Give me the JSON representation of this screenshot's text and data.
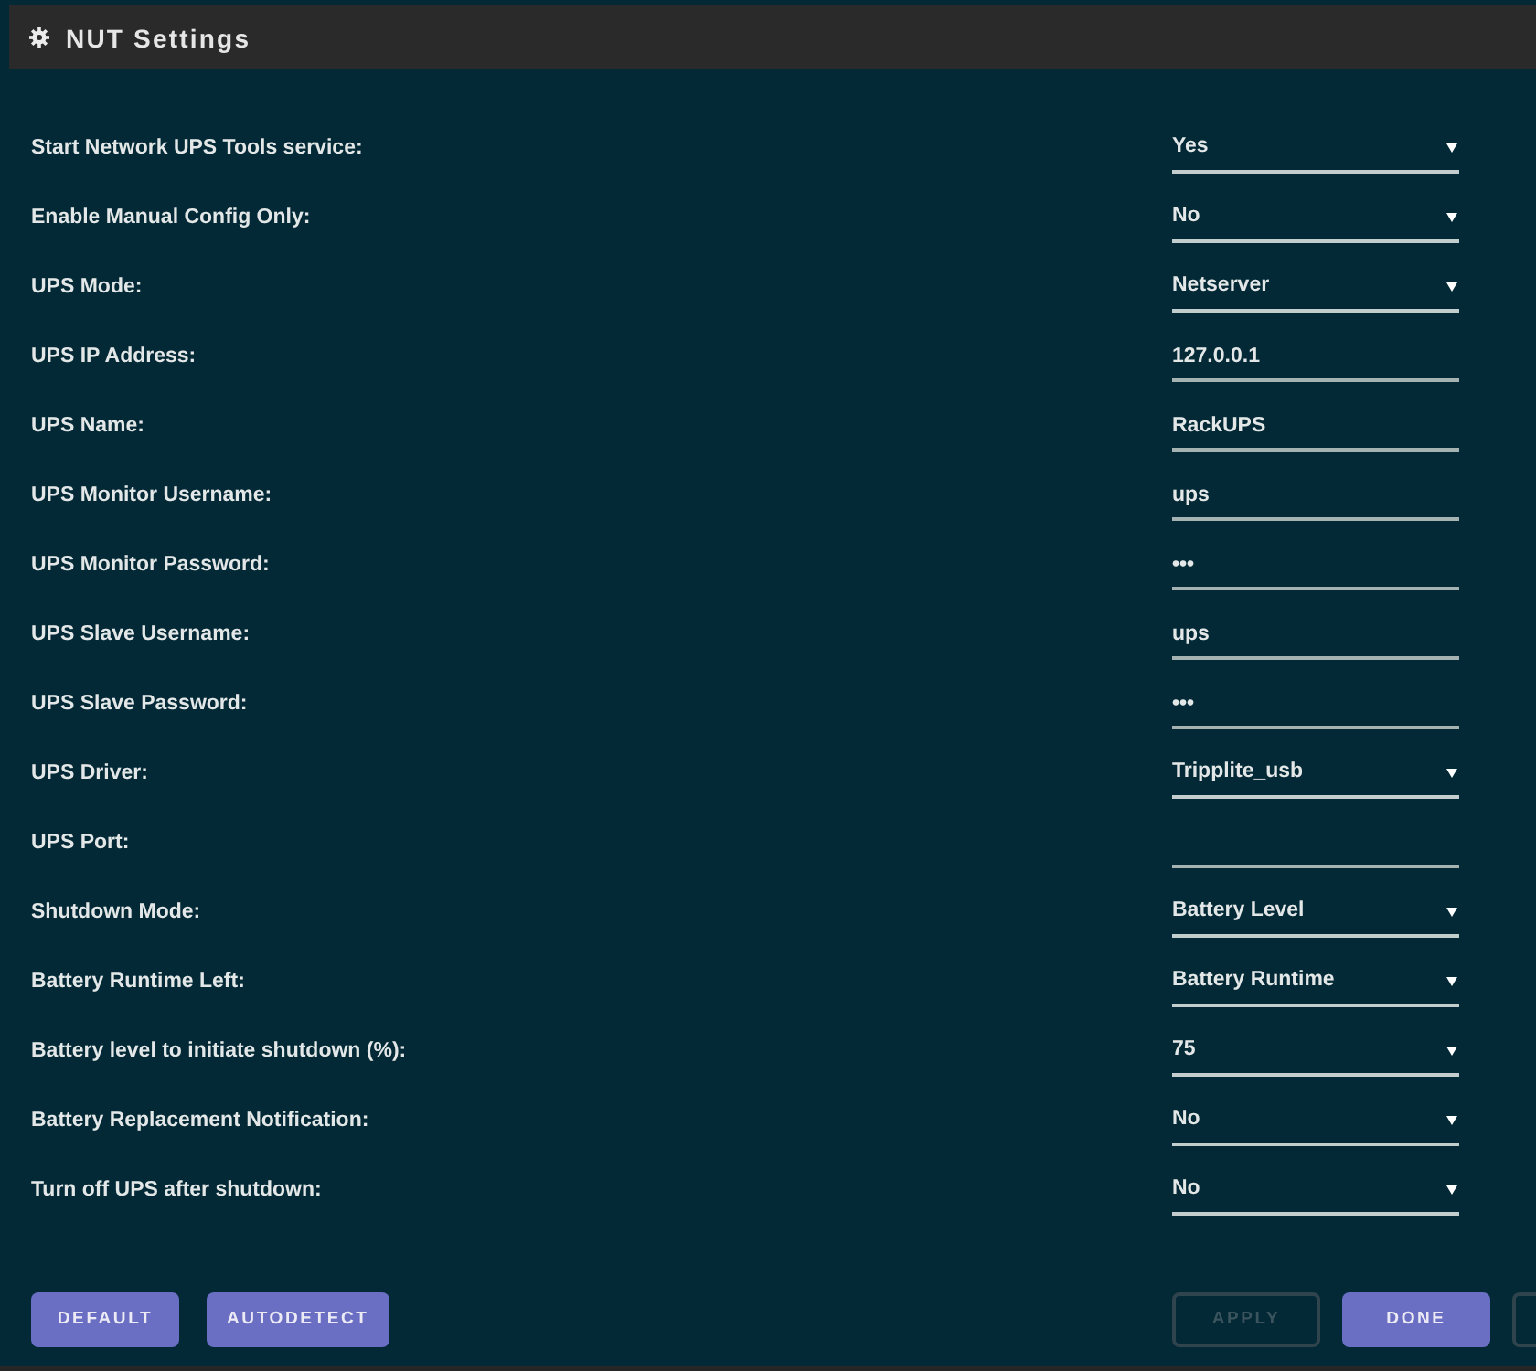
{
  "header": {
    "title": "NUT Settings"
  },
  "settings": [
    {
      "label": "Start Network UPS Tools service:",
      "kind": "select",
      "value": "Yes"
    },
    {
      "label": "Enable Manual Config Only:",
      "kind": "select",
      "value": "No"
    },
    {
      "label": "UPS Mode:",
      "kind": "select",
      "value": "Netserver"
    },
    {
      "label": "UPS IP Address:",
      "kind": "text",
      "value": "127.0.0.1"
    },
    {
      "label": "UPS Name:",
      "kind": "text",
      "value": "RackUPS"
    },
    {
      "label": "UPS Monitor Username:",
      "kind": "text",
      "value": "ups"
    },
    {
      "label": "UPS Monitor Password:",
      "kind": "text",
      "value": "•••"
    },
    {
      "label": "UPS Slave Username:",
      "kind": "text",
      "value": "ups"
    },
    {
      "label": "UPS Slave Password:",
      "kind": "text",
      "value": "•••"
    },
    {
      "label": "UPS Driver:",
      "kind": "select",
      "value": "Tripplite_usb"
    },
    {
      "label": "UPS Port:",
      "kind": "text"
    },
    {
      "label": "Shutdown Mode:",
      "kind": "select",
      "value": "Battery Level"
    },
    {
      "label": "Battery Runtime Left:",
      "kind": "select",
      "value": "Battery Runtime"
    },
    {
      "label": "Battery level to initiate shutdown (%):",
      "kind": "select",
      "value": "75"
    },
    {
      "label": "Battery Replacement Notification:",
      "kind": "select",
      "value": "No"
    },
    {
      "label": "Turn off UPS after shutdown:",
      "kind": "select",
      "value": "No"
    }
  ],
  "actions": {
    "left": [
      {
        "label": "DEFAULT",
        "kind": "primary",
        "disabled": false
      },
      {
        "label": "AUTODETECT",
        "kind": "primary",
        "disabled": false
      }
    ],
    "right": [
      {
        "label": "APPLY",
        "kind": "outline",
        "disabled": true
      },
      {
        "label": "DONE",
        "kind": "primary",
        "disabled": false
      },
      {
        "kind": "outline",
        "disabled": true
      }
    ]
  }
}
